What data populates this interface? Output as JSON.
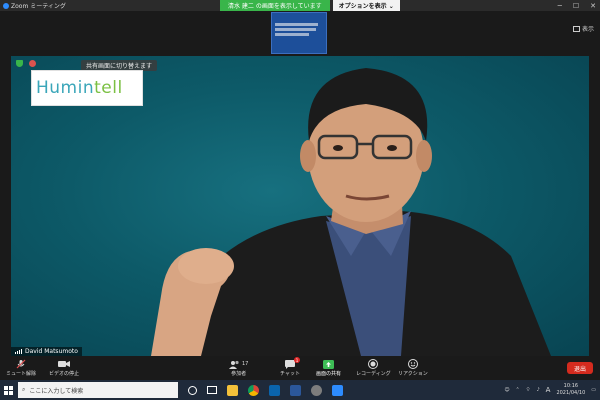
{
  "window": {
    "app_title": "Zoom ミーティング",
    "share_banner": "清水 建二 の画面を表示しています",
    "share_options": "オプションを表示 ⌄",
    "view_label": "表示"
  },
  "video": {
    "fit_button": "共有画面に切り替えます",
    "logo_text_a": "Humin",
    "logo_text_b": "tell",
    "participant_name": "David Matsumoto"
  },
  "toolbar": {
    "mute": "ミュート解除",
    "stop_video": "ビデオの停止",
    "participants": "参加者",
    "participants_count": "17",
    "chat": "チャット",
    "chat_badge": "1",
    "share": "画面の共有",
    "record": "レコーディング",
    "reactions": "リアクション",
    "end": "退出"
  },
  "taskbar": {
    "search_placeholder": "ここに入力して検索",
    "time": "10:16",
    "date": "2021/04/10",
    "ime": "A"
  },
  "colors": {
    "zoom_blue": "#2d8cff",
    "share_green": "#39b54a",
    "end_red": "#d52b1e",
    "video_bg": "#0d5a68"
  }
}
